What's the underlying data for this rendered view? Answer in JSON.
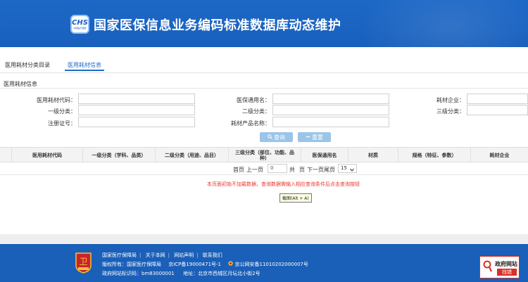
{
  "header": {
    "logo_text": "CHS",
    "logo_subtext": "中国医疗保障",
    "title": "国家医保信息业务编码标准数据库动态维护"
  },
  "tabs": [
    {
      "label": "医用耗材分类目录"
    },
    {
      "label": "医用耗材信息"
    }
  ],
  "active_tab": "医用耗材信息",
  "section_title": "医用耗材信息",
  "form": {
    "material_code_label": "医用耗材代码：",
    "insurance_name_label": "医保通用名：",
    "company_label": "耗材企业：",
    "level1_label": "一级分类：",
    "level2_label": "二级分类：",
    "level3_label": "三级分类：",
    "reg_no_label": "注册证号：",
    "product_name_label": "耗材产品名称："
  },
  "buttons": {
    "search": "查询",
    "reset": "重置"
  },
  "table": {
    "columns": [
      "医用耗材代码",
      "一级分类（学科、品类）",
      "二级分类（用途、品目）",
      "三级分类（部位、功能、品种）",
      "医保通用名",
      "材质",
      "规格（特征、参数）",
      "耗材企业"
    ]
  },
  "pager": {
    "first": "首页",
    "prev": "上一页",
    "page_value": "0",
    "total": "共",
    "page_unit": "页",
    "next": "下一页",
    "last": "尾页",
    "page_size": "15"
  },
  "notice": "本页面初始不加载数据，查询数据需输入相应查询条件后点击查询按钮",
  "tooltip": "截图(Alt + A)",
  "footer": {
    "links": [
      "国家医疗保障局",
      "关于本网",
      "网站声明",
      "联系我们"
    ],
    "copyright": "版权所有：国家医疗保障局",
    "icp": "京ICP备19000471号-1",
    "police": "京公网安备11010202000007号",
    "site_id": "政府网站标识码：bm83000001",
    "address": "地址：北京市西城区月坛北小街2号",
    "gov_badge_top": "政府网站",
    "gov_badge_bottom": "找错"
  },
  "colors": {
    "brand_blue": "#1d68c6",
    "link_blue": "#1f6dc7",
    "button_blue": "#9bc4e9",
    "notice_red": "#e8352a"
  },
  "icons": {
    "search": "search-icon",
    "reset": "minus-icon",
    "emblem": "national-emblem-icon",
    "police": "police-badge-icon"
  }
}
